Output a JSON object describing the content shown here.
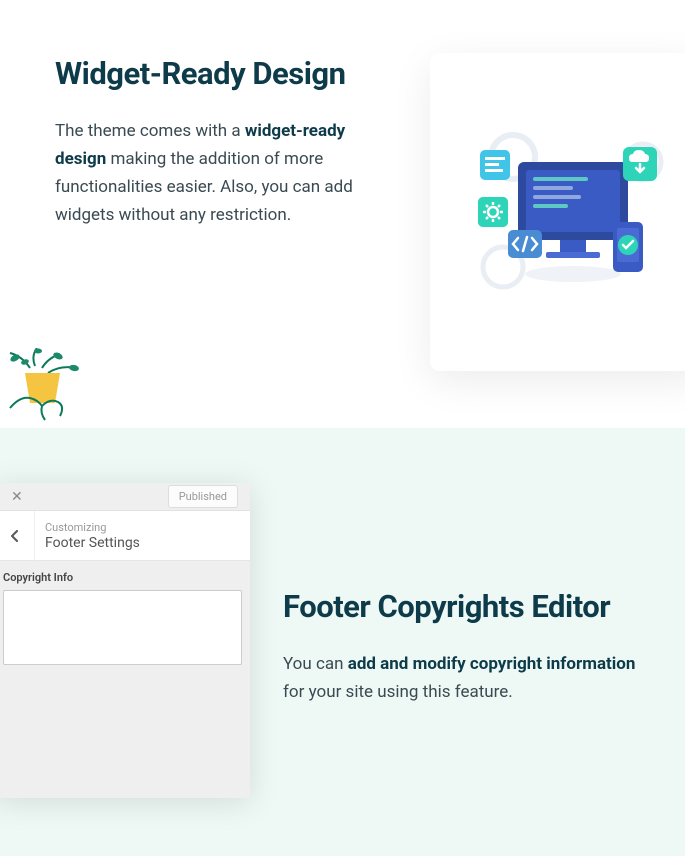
{
  "section1": {
    "heading": "Widget-Ready Design",
    "body_pre": "The theme comes with a ",
    "body_bold": "widget-ready design",
    "body_post": " making the addition of more functionalities easier. Also, you can add widgets without any restriction."
  },
  "section2": {
    "heading": "Footer Copyrights Editor",
    "body_pre": "You can ",
    "body_bold": "add and modify copyright information",
    "body_post": " for your site using this feature."
  },
  "customizer": {
    "close": "✕",
    "published": "Published",
    "customizing": "Customizing",
    "footer_settings": "Footer Settings",
    "copyright_info": "Copyright Info"
  }
}
